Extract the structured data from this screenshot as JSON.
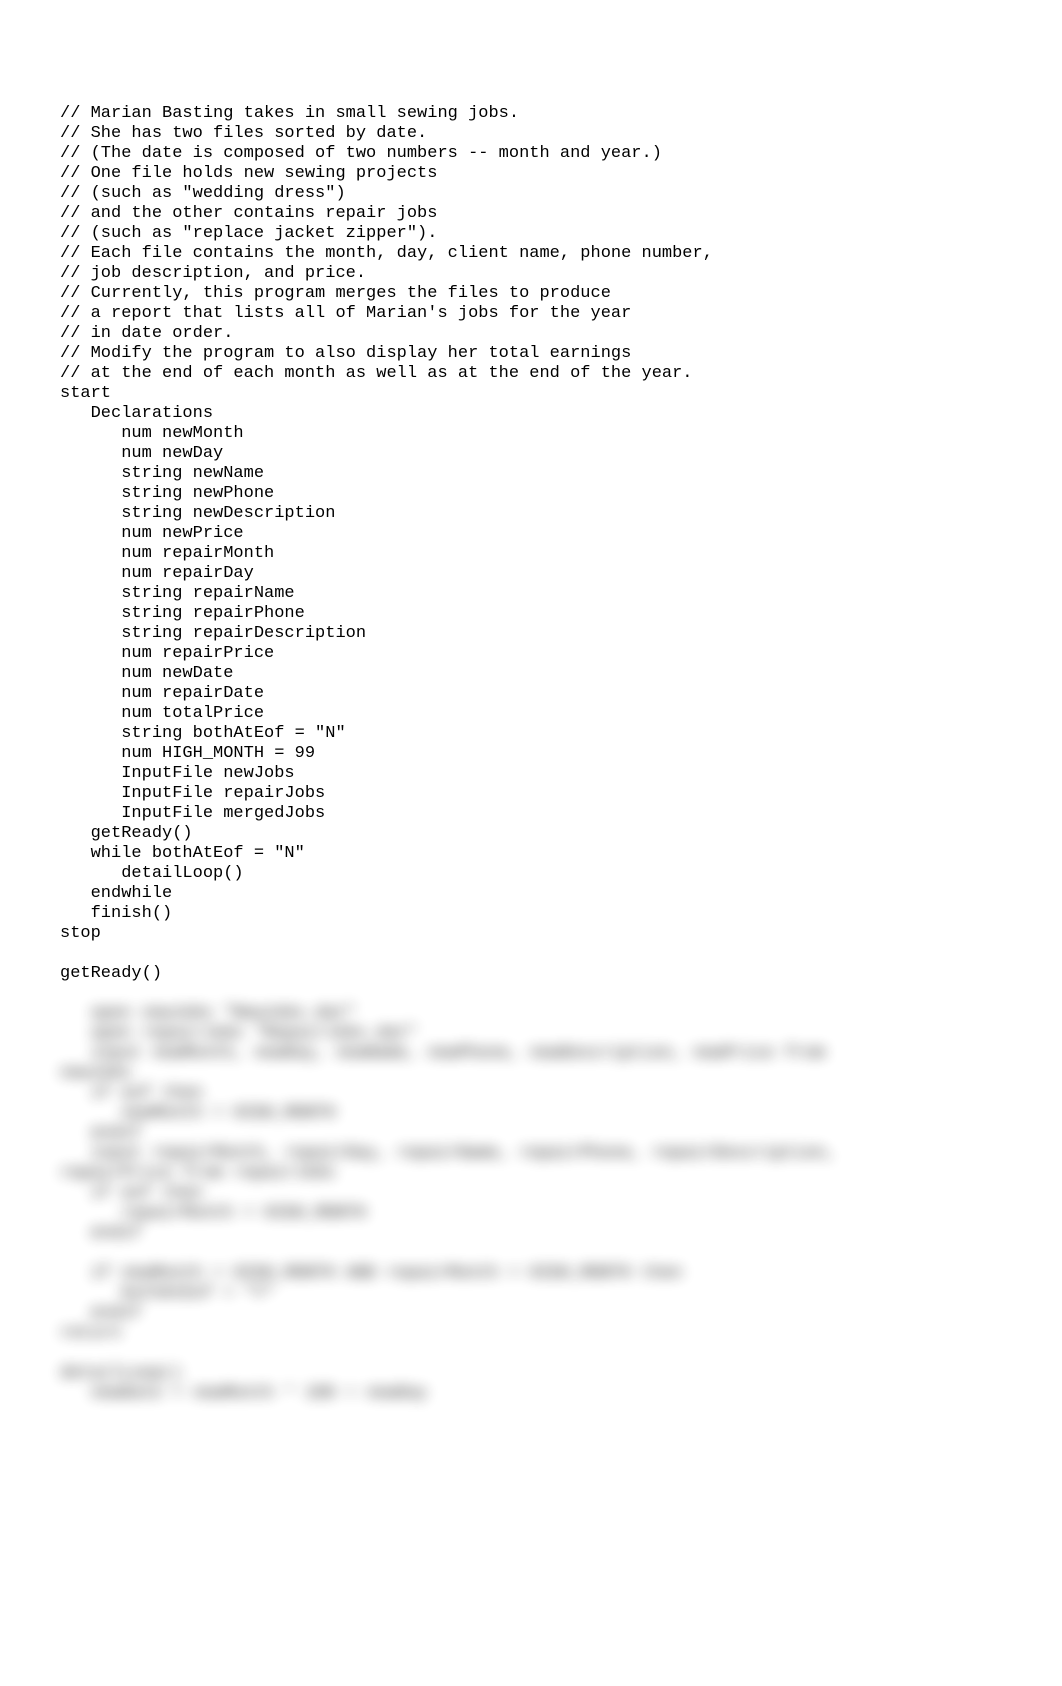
{
  "code": {
    "clear_lines": [
      "// Marian Basting takes in small sewing jobs.",
      "// She has two files sorted by date.",
      "// (The date is composed of two numbers -- month and year.)",
      "// One file holds new sewing projects",
      "// (such as \"wedding dress\")",
      "// and the other contains repair jobs",
      "// (such as \"replace jacket zipper\").",
      "// Each file contains the month, day, client name, phone number,",
      "// job description, and price.",
      "// Currently, this program merges the files to produce",
      "// a report that lists all of Marian's jobs for the year",
      "// in date order.",
      "// Modify the program to also display her total earnings",
      "// at the end of each month as well as at the end of the year.",
      "start",
      "   Declarations",
      "      num newMonth",
      "      num newDay",
      "      string newName",
      "      string newPhone",
      "      string newDescription",
      "      num newPrice",
      "      num repairMonth",
      "      num repairDay",
      "      string repairName",
      "      string repairPhone",
      "      string repairDescription",
      "      num repairPrice",
      "      num newDate",
      "      num repairDate",
      "      num totalPrice",
      "      string bothAtEof = \"N\"",
      "      num HIGH_MONTH = 99",
      "      InputFile newJobs",
      "      InputFile repairJobs",
      "      InputFile mergedJobs",
      "   getReady()",
      "   while bothAtEof = \"N\"",
      "      detailLoop()",
      "   endwhile",
      "   finish()",
      "stop",
      "",
      "getReady()"
    ],
    "blurred_lines": [
      "   open newJobs \"NewJobs.dat\"",
      "   open repairJobs \"RepairJobs.dat\"",
      "   input newMonth, newDay, newName, newPhone, newDescription, newPrice from",
      "newJobs",
      "   if eof then",
      "      newMonth = HIGH_MONTH",
      "   endif",
      "   input repairMonth, repairDay, repairName, repairPhone, repairDescription,",
      "repairPrice from repairJobs",
      "   if eof then",
      "      repairMonth = HIGH_MONTH",
      "   endif",
      "",
      "   if newMonth = HIGH_MONTH AND repairMonth = HIGH_MONTH then",
      "      bothAtEof = \"Y\"",
      "   endif",
      "return",
      "",
      "detailLoop()",
      "   newDate = newMonth * 100 + newDay"
    ]
  }
}
